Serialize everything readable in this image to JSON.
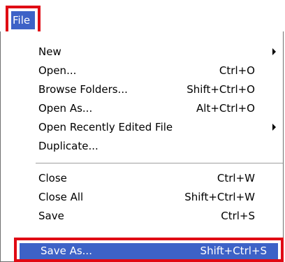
{
  "menu": {
    "title": "File",
    "items": [
      {
        "label": "New",
        "shortcut": "",
        "submenu": true
      },
      {
        "label": "Open...",
        "shortcut": "Ctrl+O",
        "submenu": false
      },
      {
        "label": "Browse Folders...",
        "shortcut": "Shift+Ctrl+O",
        "submenu": false
      },
      {
        "label": "Open As...",
        "shortcut": "Alt+Ctrl+O",
        "submenu": false
      },
      {
        "label": "Open Recently Edited File",
        "shortcut": "",
        "submenu": true
      },
      {
        "label": "Duplicate...",
        "shortcut": "",
        "submenu": false
      },
      {
        "label": "Close",
        "shortcut": "Ctrl+W",
        "submenu": false
      },
      {
        "label": "Close All",
        "shortcut": "Shift+Ctrl+W",
        "submenu": false
      },
      {
        "label": "Save",
        "shortcut": "Ctrl+S",
        "submenu": false
      },
      {
        "label": "Save As...",
        "shortcut": "Shift+Ctrl+S",
        "submenu": false,
        "selected": true
      }
    ]
  },
  "colors": {
    "highlight": "#3d62c7",
    "callout_border": "#e00a14"
  },
  "icons": {
    "submenu": "chevron-right-icon"
  }
}
